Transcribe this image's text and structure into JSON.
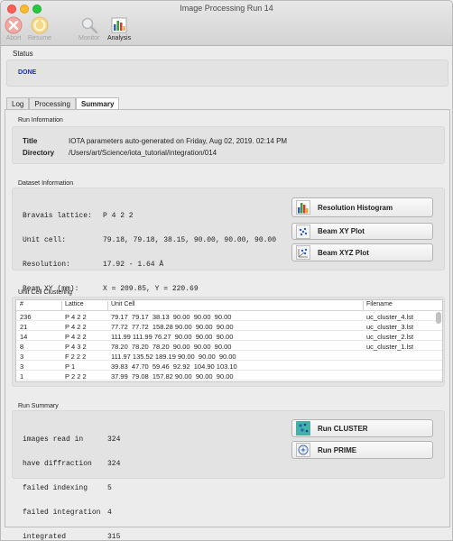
{
  "window": {
    "title": "Image Processing Run 14"
  },
  "toolbar": {
    "abort_label": "Abort",
    "resume_label": "Resume",
    "monitor_label": "Monitor",
    "analysis_label": "Analysis"
  },
  "status": {
    "title": "Status",
    "value": "DONE",
    "value_color": "#1d2bd6"
  },
  "tabs": {
    "log": "Log",
    "processing": "Processing",
    "summary": "Summary",
    "active": "Summary"
  },
  "run_info": {
    "title": "Run Information",
    "title_key": "Title",
    "title_value": "IOTA parameters auto-generated on Friday, Aug 02, 2019. 02:14 PM",
    "dir_key": "Directory",
    "dir_value": "/Users/art/Science/iota_tutorial/integration/014"
  },
  "dataset": {
    "title": "Dataset Information",
    "rows": [
      {
        "label": "Bravais lattice:",
        "value": "P 4 2 2"
      },
      {
        "label": "Unit cell:",
        "value": "79.18, 79.18, 38.15, 90.00, 90.00, 90.00"
      },
      {
        "label": "Resolution:",
        "value": "17.92 - 1.64 Å"
      },
      {
        "label": "Beam XY (mm):",
        "value": "X = 209.85, Y = 220.69"
      }
    ],
    "buttons": {
      "resolution_histogram": "Resolution Histogram",
      "beam_xy_plot": "Beam XY Plot",
      "beam_xyz_plot": "Beam XYZ Plot"
    }
  },
  "clustering": {
    "title": "Unit Cell Clustering",
    "columns": [
      "#",
      "Lattice",
      "Unit Cell",
      "Filename"
    ],
    "rows": [
      [
        "236",
        "P 4 2 2",
        "79.17  79.17  38.13  90.00  90.00  90.00",
        "uc_cluster_4.lst"
      ],
      [
        "21",
        "P 4 2 2",
        "77.72  77.72  158.28 90.00  90.00  90.00",
        "uc_cluster_3.lst"
      ],
      [
        "14",
        "P 4 2 2",
        "111.99 111.99 76.27  90.00  90.00  90.00",
        "uc_cluster_2.lst"
      ],
      [
        "8",
        "P 4 3 2",
        "78.20  78.20  78.20  90.00  90.00  90.00",
        "uc_cluster_1.lst"
      ],
      [
        "3",
        "F 2 2 2",
        "111.97 135.52 189.19 90.00  90.00  90.00",
        ""
      ],
      [
        "3",
        "P 1",
        "39.83  47.70  59.46  92.92  104.90 103.10",
        ""
      ],
      [
        "1",
        "P 2 2 2",
        "37.99  79.08  157.82 90.00  90.00  90.00",
        ""
      ]
    ]
  },
  "run_summary": {
    "title": "Run Summary",
    "rows": [
      {
        "label": "images read in",
        "value": "324"
      },
      {
        "label": "have diffraction",
        "value": "324"
      },
      {
        "label": "failed indexing",
        "value": "5"
      },
      {
        "label": "failed integration",
        "value": "4"
      },
      {
        "label": "integrated",
        "value": "315"
      }
    ],
    "buttons": {
      "run_cluster": "Run CLUSTER",
      "run_prime": "Run PRIME"
    }
  }
}
